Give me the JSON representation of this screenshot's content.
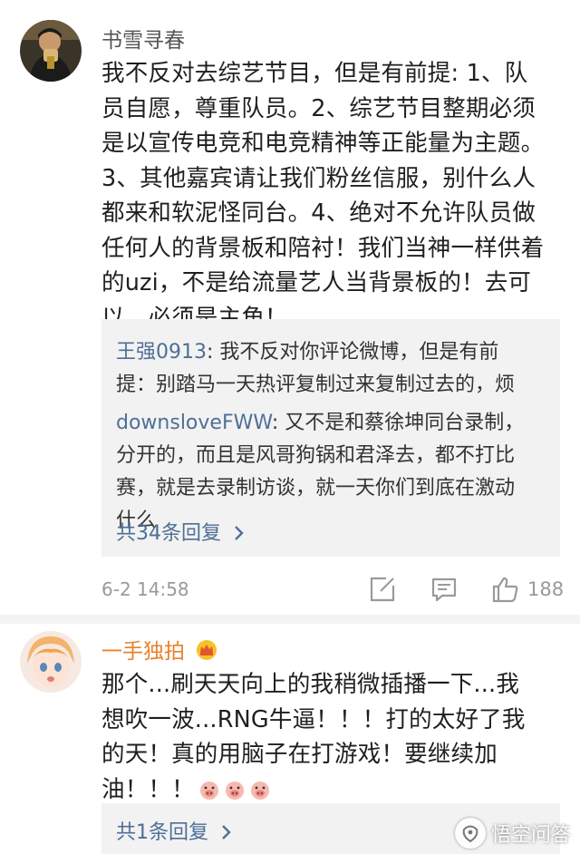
{
  "comments": [
    {
      "username": "书雪寻春",
      "text_lines": [
        "我不反对去综艺节目，但是有前提: 1、队",
        "员自愿，尊重队员。2、综艺节目整期必须",
        "是以宣传电竞和电竞精神等正能量为主题。",
        "3、其他嘉宾请让我们粉丝信服，别什么人",
        "都来和软泥怪同台。4、绝对不允许队员做",
        "任何人的背景板和陪衬！我们当神一样供着",
        "的uzi，不是给流量艺人当背景板的！去可",
        "以，必须是主角！"
      ],
      "replies": [
        {
          "user": "王强0913",
          "lines": [
            "我不反对你评论微博，但是有前",
            "提：别踏马一天热评复制过来复制过去的，烦"
          ]
        },
        {
          "user": "downsloveFWW",
          "lines": [
            "又不是和蔡徐坤同台录制，",
            "分开的，而且是风哥狗锅和君泽去，都不打比",
            "赛，就是去录制访谈，就一天你们到底在激动",
            "什么"
          ]
        }
      ],
      "more_replies": "共34条回复",
      "timestamp": "6-2 14:58",
      "likes": "188"
    },
    {
      "username": "一手独拍",
      "text_lines": [
        "那个...刷天天向上的我稍微插播一下...我",
        "想吹一波...RNG牛逼！！！打的太好了我",
        "的天！真的用脑子在打游戏！要继续加",
        "油！！！"
      ],
      "more_replies": "共1条回复"
    }
  ],
  "watermark": {
    "text": "悟空问答"
  },
  "colors": {
    "link": "#4e6f97",
    "username": "#555555",
    "vip_username": "#e8822a",
    "reply_bg": "#f2f2f2",
    "muted": "#999999"
  },
  "icons": {
    "comment": "compose-icon",
    "share": "chat-icon",
    "like": "thumbs-up-icon",
    "more": "chevron-right-icon",
    "badge": "crown-icon",
    "emoji": "pig-emoji-icon"
  }
}
